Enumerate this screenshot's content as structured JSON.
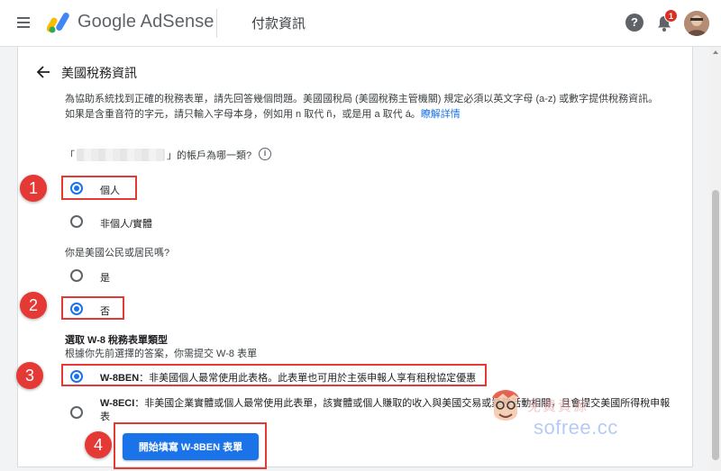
{
  "topbar": {
    "brand": "Google AdSense",
    "page_title": "付款資訊",
    "help_symbol": "?",
    "notification_count": "1"
  },
  "card": {
    "title": "美國稅務資訊",
    "intro_line1": "為協助系統找到正確的稅務表單，請先回答幾個問題。美國國稅局 (美國稅務主管機關) 規定必須以英文字母 (a-z) 或數字提供稅務資訊。",
    "intro_line2": "如果是含重音符的字元，請只輸入字母本身，例如用 n 取代 ñ，或是用 a 取代 á。",
    "learn_more": "瞭解詳情",
    "q1_prefix": "「",
    "q1_suffix": "」的帳戶為哪一類?",
    "info_symbol": "i",
    "account_type_options": [
      {
        "label": "個人",
        "checked": true
      },
      {
        "label": "非個人/實體",
        "checked": false
      }
    ],
    "q2": "你是美國公民或居民嗎?",
    "citizen_options": [
      {
        "label": "是",
        "checked": false
      },
      {
        "label": "否",
        "checked": true
      }
    ],
    "section_title": "選取 W-8 稅務表單類型",
    "section_sub": "根據你先前選擇的答案，你需提交 W-8 表單",
    "form_options": [
      {
        "code": "W-8BEN",
        "desc": "：非美國個人最常使用此表格。此表單也可用於主張申報人享有租稅協定優惠",
        "checked": true
      },
      {
        "code": "W-8ECI",
        "desc": "：非美國企業實體或個人最常使用此表單，該實體或個人賺取的收入與美國交易或業務活動相關，且會提交美國所得稅申報表",
        "checked": false
      }
    ],
    "start_button": "開始填寫 W-8BEN 表單"
  },
  "annotations": {
    "step_labels": [
      "1",
      "2",
      "3",
      "4"
    ],
    "highlight_color": "#e53935"
  },
  "watermark": {
    "text": "sofree.cc",
    "title": "免費資源"
  },
  "colors": {
    "accent": "#1a73e8",
    "annotation_red": "#e53935",
    "badge_red": "#d93025"
  }
}
